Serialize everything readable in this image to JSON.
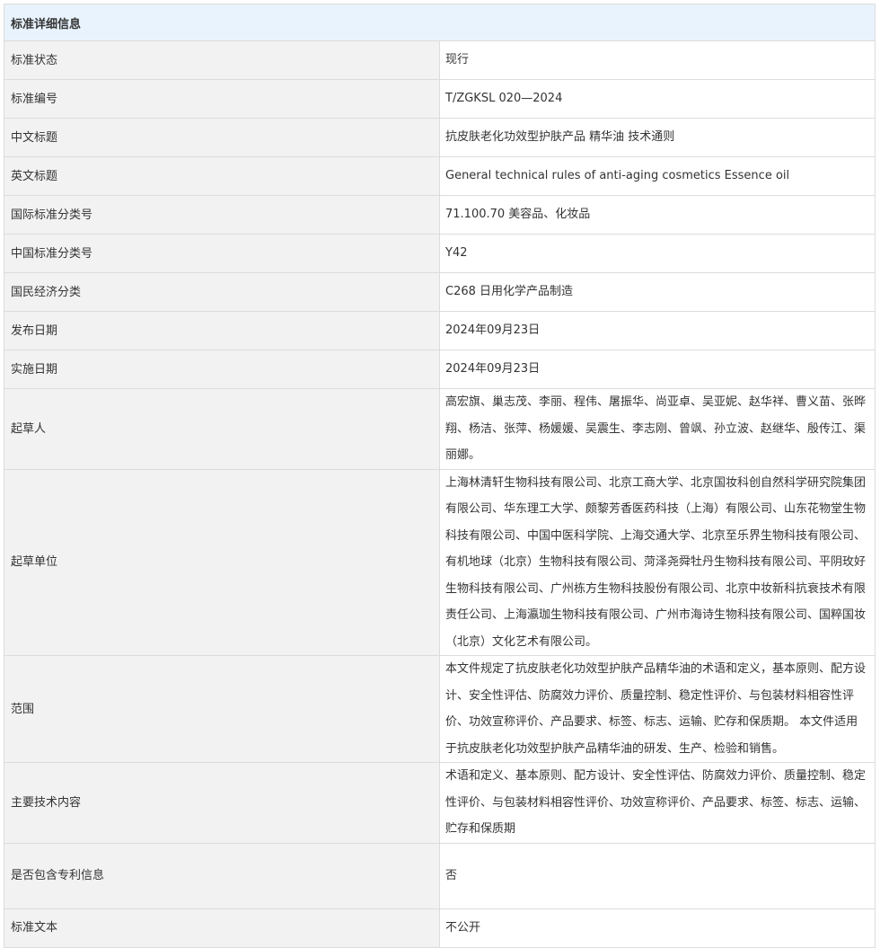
{
  "header": {
    "title": "标准详细信息"
  },
  "rows": [
    {
      "label": "标准状态",
      "value": "现行"
    },
    {
      "label": "标准编号",
      "value": "T/ZGKSL 020—2024"
    },
    {
      "label": "中文标题",
      "value": "抗皮肤老化功效型护肤产品 精华油 技术通则"
    },
    {
      "label": "英文标题",
      "value": "General technical rules of anti-aging cosmetics Essence oil"
    },
    {
      "label": "国际标准分类号",
      "value": "71.100.70 美容品、化妆品"
    },
    {
      "label": "中国标准分类号",
      "value": "Y42"
    },
    {
      "label": "国民经济分类",
      "value": "C268 日用化学产品制造"
    },
    {
      "label": "发布日期",
      "value": "2024年09月23日"
    },
    {
      "label": "实施日期",
      "value": "2024年09月23日"
    },
    {
      "label": "起草人",
      "value": "高宏旗、巢志茂、李丽、程伟、屠振华、尚亚卓、吴亚妮、赵华祥、曹义苗、张晔翔、杨洁、张萍、杨媛媛、吴震生、李志刚、曾飒、孙立波、赵继华、殷传江、渠丽娜。"
    },
    {
      "label": "起草单位",
      "value": "上海林清轩生物科技有限公司、北京工商大学、北京国妆科创自然科学研究院集团有限公司、华东理工大学、颇黎芳香医药科技（上海）有限公司、山东花物堂生物科技有限公司、中国中医科学院、上海交通大学、北京至乐界生物科技有限公司、有机地球（北京）生物科技有限公司、菏泽尧舜牡丹生物科技有限公司、平阴玫好生物科技有限公司、广州栋方生物科技股份有限公司、北京中妆新科抗衰技术有限责任公司、上海瀛珈生物科技有限公司、广州市海诗生物科技有限公司、国粹国妆（北京）文化艺术有限公司。"
    },
    {
      "label": "范围",
      "value": "本文件规定了抗皮肤老化功效型护肤产品精华油的术语和定义，基本原则、配方设计、安全性评估、防腐效力评价、质量控制、稳定性评价、与包装材料相容性评价、功效宣称评价、产品要求、标签、标志、运输、贮存和保质期。 本文件适用于抗皮肤老化功效型护肤产品精华油的研发、生产、检验和销售。"
    },
    {
      "label": "主要技术内容",
      "value": "术语和定义、基本原则、配方设计、安全性评估、防腐效力评价、质量控制、稳定性评价、与包装材料相容性评价、功效宣称评价、产品要求、标签、标志、运输、贮存和保质期"
    },
    {
      "label": "是否包含专利信息",
      "value": "否"
    },
    {
      "label": "标准文本",
      "value": "不公开"
    }
  ]
}
